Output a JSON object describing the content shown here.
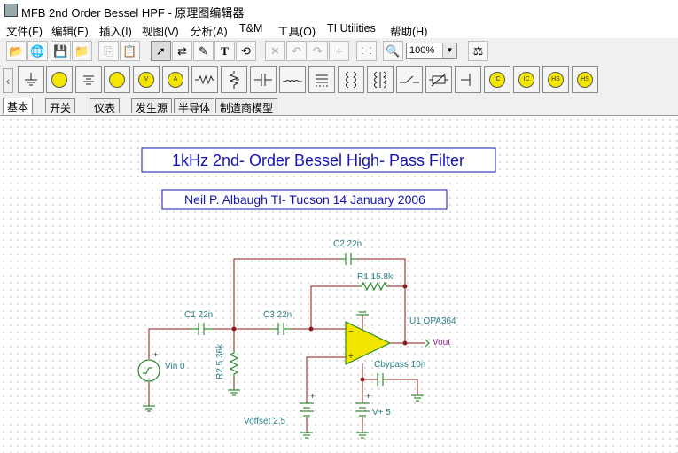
{
  "window": {
    "title": "MFB 2nd Order Bessel HPF - 原理图编辑器"
  },
  "menu": [
    "文件(F)",
    "编辑(E)",
    "插入(I)",
    "视图(V)",
    "分析(A)",
    "T&M",
    "工具(O)",
    "TI Utilities",
    "帮助(H)"
  ],
  "toolbar": {
    "buttons": [
      {
        "icon": "open-folder-icon",
        "glyph": "📂"
      },
      {
        "icon": "web-open-icon",
        "glyph": "🌐"
      },
      {
        "icon": "save-icon",
        "glyph": "💾"
      },
      {
        "icon": "open-recent-icon",
        "glyph": "📁"
      },
      {
        "icon": "copy-icon",
        "glyph": "⎘"
      },
      {
        "icon": "paste-icon",
        "glyph": "📋"
      },
      {
        "icon": "select-arrow-icon",
        "glyph": "➚"
      },
      {
        "icon": "wire-select-icon",
        "glyph": "⇄"
      },
      {
        "icon": "pencil-icon",
        "glyph": "✎"
      },
      {
        "icon": "text-icon",
        "glyph": "T"
      },
      {
        "icon": "rotate-icon",
        "glyph": "⟲"
      },
      {
        "icon": "delete-icon",
        "glyph": "✕"
      },
      {
        "icon": "undo-icon",
        "glyph": "↶"
      },
      {
        "icon": "redo-icon",
        "glyph": "↷"
      },
      {
        "icon": "junction-icon",
        "glyph": "+"
      },
      {
        "icon": "grid-icon",
        "glyph": "⋮⋮"
      },
      {
        "icon": "zoom-icon",
        "glyph": "🔍"
      },
      {
        "icon": "ti-analysis-icon",
        "glyph": "⚖"
      }
    ],
    "zoom_value": "100%"
  },
  "component_palette": [
    "ground-icon",
    "battery-icon",
    "voltage-source-icon",
    "voltmeter-icon",
    "ammeter-icon",
    "resistor-icon",
    "potentiometer-icon",
    "capacitor-icon",
    "inductor-icon",
    "transformer-icon",
    "coupled-inductor-icon",
    "switch-icon",
    "varistor-icon",
    "wire-icon",
    "current-probe-icon",
    "dc-current-probe-icon",
    "hs-meter-icon",
    "hs-meter-2-icon"
  ],
  "palette_labels": {
    "ic1": "IC",
    "ic2": "IC",
    "hs1": "HS",
    "hs2": "HS"
  },
  "tabs": [
    "基本",
    "开关",
    "仪表",
    "发生源",
    "半导体",
    "制造商模型"
  ],
  "schematic": {
    "title": "1kHz 2nd- Order Bessel High- Pass Filter",
    "author": "Neil P. Albaugh  TI- Tucson  14 January 2006",
    "labels": {
      "c2": "C2 22n",
      "r1": "R1 15.8k",
      "c1": "C1 22n",
      "c3": "C3 22n",
      "u1": "U1 OPA364",
      "vout": "Vout",
      "r2": "R2 5.36k",
      "vin": "Vin 0",
      "cbypass": "Cbypass 10n",
      "voffset": "Voffset 2.5",
      "vplus": "V+ 5"
    },
    "colors": {
      "wire": "#8b1a1a",
      "component": "#2e8b2e",
      "opamp": "#f2e500",
      "label": "#2a7f86",
      "title": "#1414b4",
      "vout": "#8b2a8b"
    }
  }
}
